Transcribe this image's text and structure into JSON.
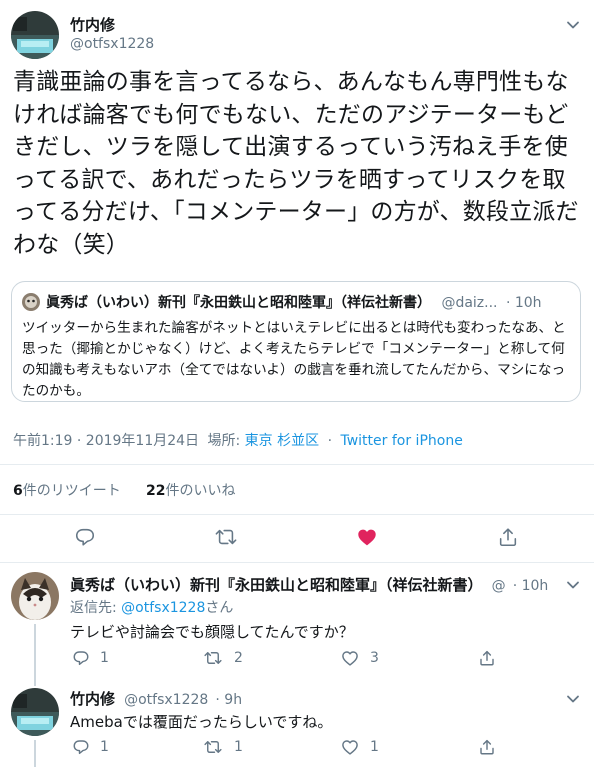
{
  "main_tweet": {
    "author_name": "竹内修",
    "author_handle": "@otfsx1228",
    "text": "青識亜論の事を言ってるなら、あんなもん専門性もなければ論客でも何でもない、ただのアジテーターもどきだし、ツラを隠して出演するっていう汚ねえ手を使ってる訳で、あれだったらツラを晒すってリスクを取ってる分だけ、「コメンテーター」の方が、数段立派だわな（笑）",
    "quote": {
      "author_name": "眞秀ば（いわい）新刊『永田鉄山と昭和陸軍』（祥伝社新書）",
      "author_handle": "@daiz...",
      "time": "· 10h",
      "text": "ツイッターから生まれた論客がネットとはいえテレビに出るとは時代も変わったなあ、と思った（揶揄とかじゃなく）けど、よく考えたらテレビで「コメンテーター」と称して何の知識も考えもないアホ（全てではないよ）の戯言を垂れ流してたんだから、マシになったのかも。"
    },
    "timestamp": "午前1:19 · 2019年11月24日",
    "location_prefix": "場所:",
    "location": "東京 杉並区",
    "separator": "·",
    "source": "Twitter for iPhone",
    "retweets_count": "6",
    "retweets_label": "件のリツイート",
    "likes_count": "22",
    "likes_label": "件のいいね"
  },
  "replies": [
    {
      "author_name": "眞秀ば（いわい）新刊『永田鉄山と昭和陸軍』（祥伝社新書）",
      "author_handle": "@",
      "time": "· 10h",
      "reply_to_prefix": "返信先:",
      "reply_to_handle": "@otfsx1228",
      "reply_to_suffix": "さん",
      "text": "テレビや討論会でも顔隠してたんですか？",
      "reply_count": "1",
      "retweet_count": "2",
      "like_count": "3"
    },
    {
      "author_name": "竹内修",
      "author_handle": "@otfsx1228",
      "time": "· 9h",
      "text": "Amebaでは覆面だったらしいですね。",
      "reply_count": "1",
      "retweet_count": "1",
      "like_count": "1"
    }
  ],
  "icons": {
    "reply": "reply-icon",
    "retweet": "retweet-icon",
    "like": "heart-icon",
    "share": "share-icon",
    "menu": "chevron-down-icon"
  },
  "colors": {
    "like_active": "#e0245e",
    "link": "#1b95e0",
    "secondary": "#657786"
  }
}
